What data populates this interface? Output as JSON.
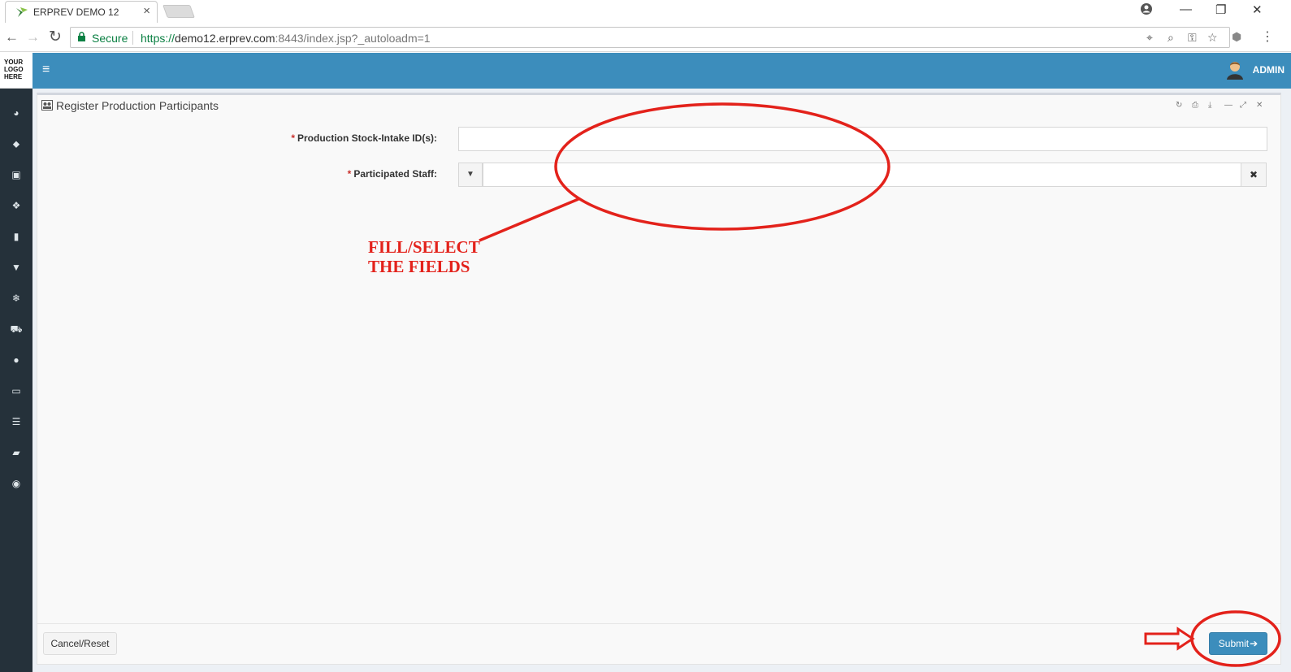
{
  "browser": {
    "tab_title": "ERPREV DEMO 12",
    "tab_close": "×",
    "secure_label": "Secure",
    "url_scheme": "https://",
    "url_host": "demo12.erprev.com",
    "url_rest": ":8443/index.jsp?_autoloadm=1",
    "back": "←",
    "forward": "→",
    "reload": "↻",
    "minimize": "—",
    "restore": "❐",
    "close": "✕",
    "menu": "⋮"
  },
  "app": {
    "logo_lines": [
      "YOUR",
      "LOGO",
      "HERE"
    ],
    "menu_icon": "≡",
    "user_label": "ADMIN",
    "accent_color": "#3c8dbc",
    "sidebar_color": "#25313a"
  },
  "sidebar": {
    "icons": [
      {
        "name": "dashboard-icon",
        "glyph": "◕"
      },
      {
        "name": "tag-icon",
        "glyph": "⬥"
      },
      {
        "name": "money-icon",
        "glyph": "▣"
      },
      {
        "name": "cubes-icon",
        "glyph": "❖"
      },
      {
        "name": "building-icon",
        "glyph": "▮"
      },
      {
        "name": "trash-icon",
        "glyph": "▼"
      },
      {
        "name": "snowflake-icon",
        "glyph": "❄"
      },
      {
        "name": "cart-icon",
        "glyph": "⛟"
      },
      {
        "name": "circle-icon",
        "glyph": "●"
      },
      {
        "name": "desktop-icon",
        "glyph": "▭"
      },
      {
        "name": "database-icon",
        "glyph": "☰"
      },
      {
        "name": "book-icon",
        "glyph": "▰"
      },
      {
        "name": "support-icon",
        "glyph": "◉"
      }
    ]
  },
  "panel": {
    "title": "Register Production Participants",
    "tools": {
      "refresh": "↻",
      "print": "⎙",
      "download": "⤓",
      "minimize": "—",
      "expand": "⤢",
      "close": "✕"
    }
  },
  "form": {
    "required_mark": "*",
    "stock_intake_label": "Production Stock-Intake ID(s):",
    "stock_intake_value": "",
    "staff_label": "Participated Staff:",
    "staff_value": "",
    "dropdown_glyph": "▼",
    "clear_glyph": "✖"
  },
  "footer": {
    "cancel_label": "Cancel/Reset",
    "submit_label": "Submit",
    "submit_glyph": "➔"
  },
  "annotation": {
    "line1": "FILL/SELECT",
    "line2": "THE FIELDS",
    "color": "#e3221b"
  }
}
